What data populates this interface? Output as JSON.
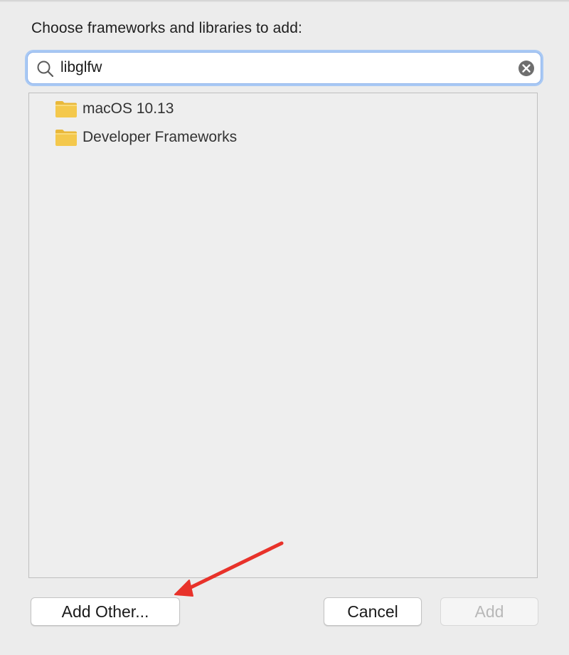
{
  "dialog": {
    "prompt": "Choose frameworks and libraries to add:"
  },
  "search": {
    "value": "libglfw",
    "icon": "magnifying-glass",
    "clear_icon": "circled-x"
  },
  "list": {
    "items": [
      {
        "label": "macOS 10.13",
        "icon": "folder"
      },
      {
        "label": "Developer Frameworks",
        "icon": "folder"
      }
    ]
  },
  "buttons": {
    "add_other": "Add Other...",
    "cancel": "Cancel",
    "add": "Add",
    "add_enabled": false
  },
  "annotation": {
    "arrow_color": "#e8322a",
    "points_to": "add-other-button"
  },
  "colors": {
    "window_bg": "#ececec",
    "focus_ring": "#a9c9f4",
    "folder": "#f2c94c"
  }
}
